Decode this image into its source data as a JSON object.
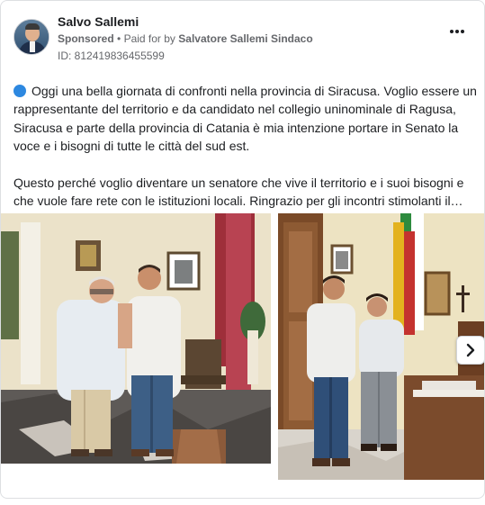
{
  "post": {
    "author": "Salvo Sallemi",
    "sponsored_label": "Sponsored",
    "separator": "•",
    "paid_for_prefix": "Paid for by",
    "payer": "Salvatore Sallemi Sindaco",
    "ad_id": "ID: 812419836455599",
    "more_icon": "more-options-icon",
    "text_paragraph_1": "Oggi una bella giornata di confronti nella provincia di Siracusa. Voglio essere un rappresentante del territorio e da candidato nel collegio uninominale di Ragusa, Siracusa e parte della provincia di Catania è mia intenzione portare in Senato la voce e i bisogni di tutte le città del sud est.",
    "text_paragraph_2": "Questo perché voglio diventare un senatore che vive il territorio e i suoi bisogni e che vuole fare rete con le istituzioni locali. Ringrazio per gli incontri stimolanti il…",
    "bullet_color": "#2d88e0"
  },
  "carousel": {
    "next_symbol": "›",
    "items": [
      {
        "icon": "photo-two-men-office"
      },
      {
        "icon": "photo-two-men-mayor-office"
      }
    ]
  }
}
